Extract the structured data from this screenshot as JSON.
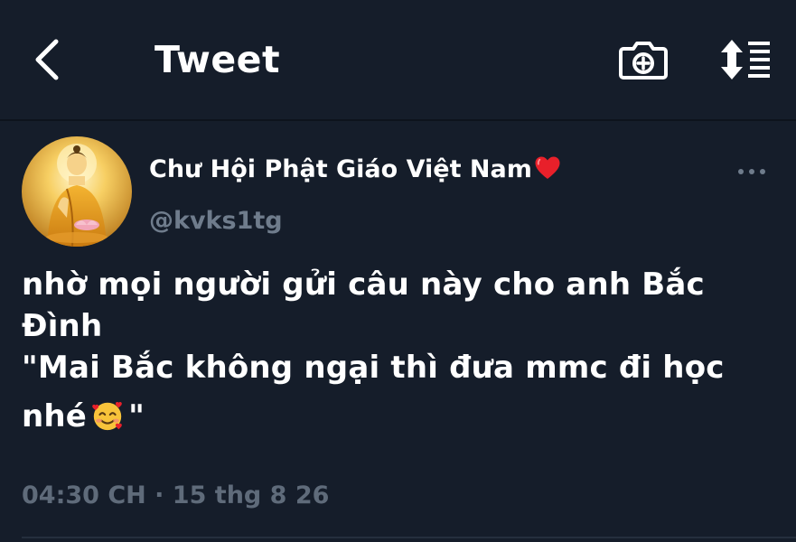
{
  "header": {
    "title": "Tweet",
    "back_icon": "chevron-left-icon",
    "camera_icon": "camera-plus-icon",
    "sort_icon": "sort-lines-icon"
  },
  "tweet": {
    "author_name": "Chư Hội Phật Giáo Việt Nam",
    "author_badge_icon": "red-heart-icon",
    "handle": "@kvks1tg",
    "lines": [
      "nhờ mọi người gửi câu này cho anh Bắc",
      "Đình",
      "\"Mai Bắc không ngại thì đưa mmc đi học",
      "nhé",
      "\""
    ],
    "emoji_icon": "smiling-face-with-hearts-icon",
    "timestamp": "04:30 CH · 15 thg 8 26"
  },
  "colors": {
    "background": "#151d2a",
    "text_primary": "#ffffff",
    "text_secondary": "#6f7c8c",
    "divider": "#0d131c"
  }
}
